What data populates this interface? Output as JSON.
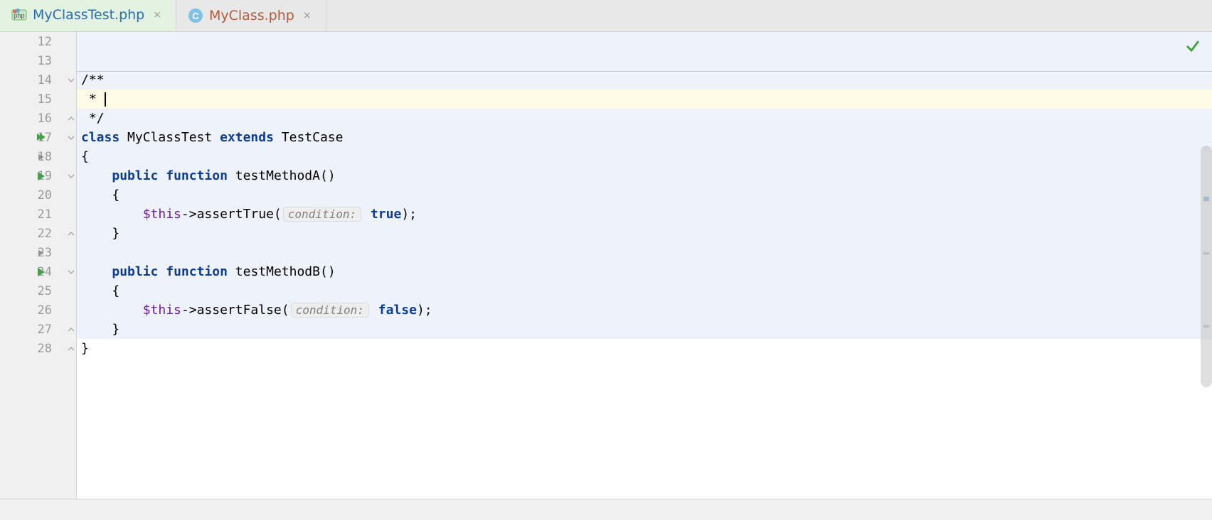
{
  "tabs": [
    {
      "label": "MyClassTest.php",
      "icon": "php-test",
      "active": true
    },
    {
      "label": "MyClass.php",
      "icon": "class",
      "active": false
    }
  ],
  "lineStart": 12,
  "lineCount": 17,
  "currentLine": 15,
  "checkmark": true,
  "code": {
    "l14": "/**",
    "l15_prefix": " * ",
    "l16": " */",
    "l17_kw1": "class",
    "l17_name": " MyClassTest ",
    "l17_kw2": "extends",
    "l17_base": " TestCase",
    "l18": "{",
    "l19_indent": "    ",
    "l19_kw1": "public",
    "l19_sp": " ",
    "l19_kw2": "function",
    "l19_name": " testMethodA()",
    "l20": "    {",
    "l21_indent": "        ",
    "l21_var": "$this",
    "l21_call": "->assertTrue(",
    "l21_hint": "condition:",
    "l21_sp": " ",
    "l21_kw": "true",
    "l21_end": ");",
    "l22": "    }",
    "l23": "",
    "l24_indent": "    ",
    "l24_kw1": "public",
    "l24_sp": " ",
    "l24_kw2": "function",
    "l24_name": " testMethodB()",
    "l25": "    {",
    "l26_indent": "        ",
    "l26_var": "$this",
    "l26_call": "->assertFalse(",
    "l26_hint": "condition:",
    "l26_sp": " ",
    "l26_kw": "false",
    "l26_end": ");",
    "l27": "    }",
    "l28": "}"
  },
  "gutterMarks": {
    "17": "run-all",
    "18": "fold",
    "19": "run",
    "23": "fold",
    "24": "run"
  }
}
